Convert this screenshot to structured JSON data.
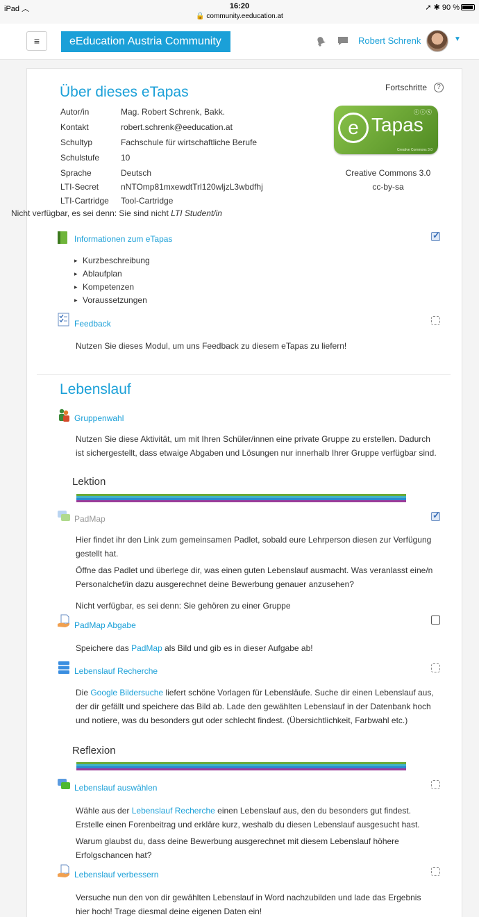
{
  "statusbar": {
    "device": "iPad",
    "time": "16:20",
    "url": "community.eeducation.at",
    "battery": "90 %"
  },
  "header": {
    "menu_icon": "hamburger-icon",
    "brand": "eEducation Austria Community",
    "user": "Robert Schrenk",
    "brand_color": "#1ba0d8"
  },
  "course": {
    "title": "Über dieses eTapas",
    "progress_label": "Fortschritte",
    "meta": [
      {
        "label": "Autor/in",
        "value": "Mag. Robert Schrenk, Bakk."
      },
      {
        "label": "Kontakt",
        "value": "robert.schrenk@eeducation.at"
      },
      {
        "label": "Schultyp",
        "value": "Fachschule für wirtschaftliche Berufe"
      },
      {
        "label": "Schulstufe",
        "value": "10"
      },
      {
        "label": "Sprache",
        "value": "Deutsch"
      },
      {
        "label": "LTI-Secret",
        "value": "nNTOmp81mxewdtTrl120wljzL3wbdfhj"
      },
      {
        "label": "LTI-Cartridge",
        "value": "Tool-Cartridge"
      }
    ],
    "license_logo_text": "eTapas",
    "license_logo_small": "Creative Commons 3.0",
    "license": "Creative Commons 3.0",
    "license_code": "cc-by-sa",
    "restriction_prefix": "Nicht verfügbar, es sei denn: Sie sind nicht ",
    "restriction_role": "LTI Student/in"
  },
  "intro_activities": {
    "info": {
      "label": "Informationen zum eTapas",
      "items": [
        "Kurzbeschreibung",
        "Ablaufplan",
        "Kompetenzen",
        "Voraussetzungen"
      ]
    },
    "feedback": {
      "label": "Feedback",
      "desc": "Nutzen Sie dieses Modul, um uns Feedback zu diesem eTapas zu liefern!"
    }
  },
  "section": {
    "title": "Lebenslauf",
    "groupchoice": {
      "label": "Gruppenwahl",
      "desc": "Nutzen Sie diese Aktivität, um mit Ihren Schüler/innen eine private Gruppe zu erstellen. Dadurch ist sichergestellt, dass etwaige Abgaben und Lösungen nur innerhalb Ihrer Gruppe verfügbar sind."
    },
    "lektion": "Lektion",
    "padmap": {
      "label": "PadMap",
      "desc1": "Hier findet ihr den Link zum gemeinsamen Padlet, sobald eure Lehrperson diesen zur Verfügung gestellt hat.",
      "desc2": "Öffne das Padlet und überlege dir, was einen guten Lebenslauf ausmacht. Was veranlasst eine/n Personalchef/in dazu ausgerechnet deine Bewerbung genauer anzusehen?",
      "restriction": "Nicht verfügbar, es sei denn: Sie gehören zu einer Gruppe"
    },
    "padmap_submit": {
      "label": "PadMap Abgabe",
      "desc_a": "Speichere das ",
      "desc_link": "PadMap",
      "desc_b": " als Bild und gib es in dieser Aufgabe ab!"
    },
    "research": {
      "label": "Lebenslauf Recherche",
      "desc_a": "Die ",
      "desc_link": "Google Bildersuche",
      "desc_b": " liefert schöne Vorlagen für Lebensläufe. Suche dir einen Lebenslauf aus, der dir gefällt und speichere das Bild ab. Lade den gewählten Lebenslauf in der Datenbank hoch und notiere, was du besonders gut oder schlecht findest. (Übersichtlichkeit, Farbwahl etc.)"
    },
    "reflexion": "Reflexion",
    "choose": {
      "label": "Lebenslauf auswählen",
      "desc_a": "Wähle aus der ",
      "desc_link": "Lebenslauf Recherche",
      "desc_b": " einen Lebenslauf aus, den du besonders gut findest. Erstelle einen Forenbeitrag und erkläre kurz, weshalb du diesen Lebenslauf ausgesucht hast.",
      "desc2": "Warum glaubst du, dass deine Bewerbung ausgerechnet mit diesem Lebenslauf höhere Erfolgschancen hat?"
    },
    "improve": {
      "label": "Lebenslauf verbessern",
      "desc": "Versuche nun den von dir gewählten Lebenslauf in Word nachzubilden und lade das Ergebnis hier hoch! Trage diesmal deine eigenen Daten ein!"
    }
  },
  "completion": {
    "info": "done",
    "feedback": "manual",
    "padmap": "done",
    "padmap_submit": "empty",
    "research": "manual",
    "choose": "manual",
    "improve": "manual"
  },
  "divider_colors": [
    "#6aaa3a",
    "#3fb2c8",
    "#2a8bd0",
    "#9a3c9a"
  ]
}
